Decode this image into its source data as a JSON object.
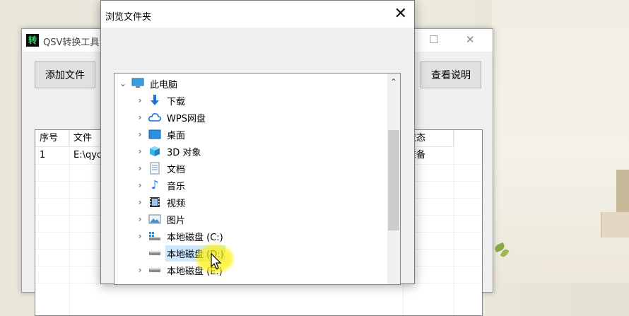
{
  "app": {
    "icon_char": "转",
    "title": "QSV转换工具",
    "add_button": "添加文件",
    "help_button": "查看说明",
    "columns": {
      "index": "序号",
      "file": "文件",
      "status": "状态"
    },
    "rows": [
      {
        "index": "1",
        "file": "E:\\qyc",
        "status": "准备"
      }
    ]
  },
  "dialog": {
    "title": "浏览文件夹",
    "close_glyph": "✕",
    "tree": {
      "root": "此电脑",
      "items": [
        {
          "label": "下载",
          "icon": "download-icon"
        },
        {
          "label": "WPS网盘",
          "icon": "cloud-icon"
        },
        {
          "label": "桌面",
          "icon": "desktop-icon"
        },
        {
          "label": "3D 对象",
          "icon": "cube-icon"
        },
        {
          "label": "文档",
          "icon": "document-icon"
        },
        {
          "label": "音乐",
          "icon": "music-icon"
        },
        {
          "label": "视频",
          "icon": "video-icon"
        },
        {
          "label": "图片",
          "icon": "picture-icon"
        },
        {
          "label": "本地磁盘 (C:)",
          "icon": "system-drive-icon"
        },
        {
          "label": "本地磁盘 (D:)",
          "icon": "drive-icon",
          "selected": true
        },
        {
          "label": "本地磁盘 (E:)",
          "icon": "drive-icon"
        }
      ]
    }
  },
  "colors": {
    "selection": "#cde8ff",
    "accent": "#1a73d9",
    "highlight": "#fff000"
  }
}
